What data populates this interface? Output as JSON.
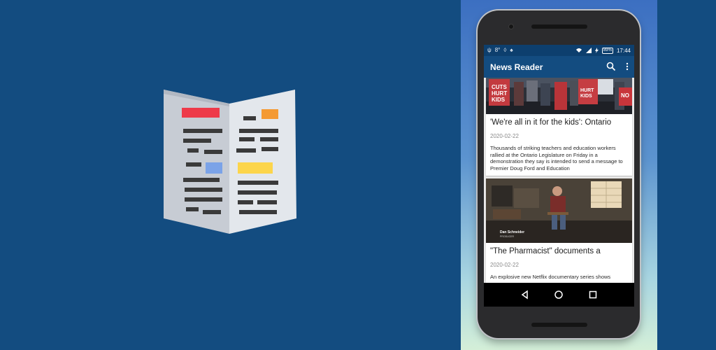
{
  "status_bar": {
    "left_icons": [
      "usb-icon",
      "temperature-icon",
      "lightbulb-icon",
      "android-icon"
    ],
    "right_icons": [
      "wifi-icon",
      "signal-icon",
      "charging-icon"
    ],
    "left_glyphs": [
      "ψ",
      "8°",
      "◊",
      "♠"
    ],
    "battery": "89%",
    "time": "17:44"
  },
  "app_bar": {
    "title": "News Reader",
    "color": "#134c80"
  },
  "articles": [
    {
      "title": "'We're all in it for the kids': Ontario",
      "date": "2020-02-22",
      "description": "Thousands of striking teachers and education workers rallied at the Ontario Legislature on Friday in a demonstration they say is intended to send a message to Premier Doug Ford and Education",
      "sign_left": [
        "CUTS",
        "HURT",
        "KIDS"
      ],
      "sign_mid": [
        "HURT",
        "KIDS"
      ],
      "sign_right": "NO"
    },
    {
      "title": "\"The Pharmacist\" documents a",
      "date": "2020-02-22",
      "description": "An explosive new Netflix documentary series shows",
      "caption": "Dan Schneider",
      "caption_sub": "PRODUCER"
    }
  ],
  "colors": {
    "background": "#134c80",
    "status_bar": "#0d3f6e"
  }
}
